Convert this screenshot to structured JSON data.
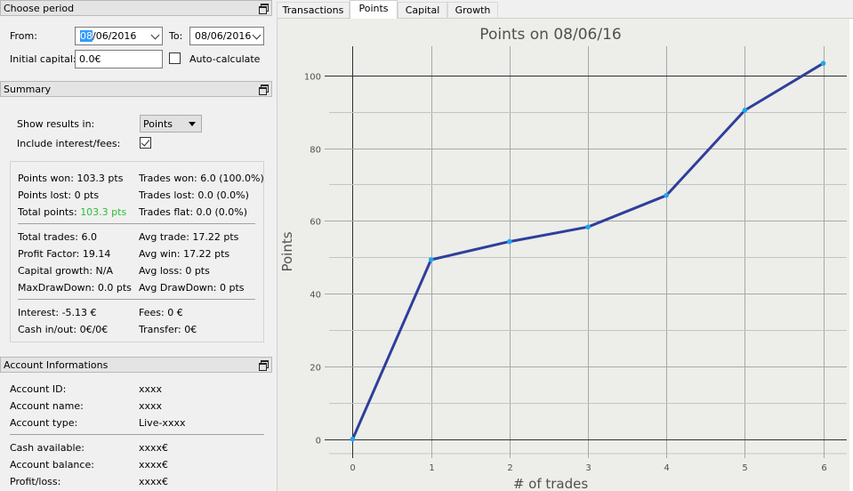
{
  "choose_period": {
    "title": "Choose period",
    "from_label": "From:",
    "from_value_hl": "08",
    "from_value_rest": "/06/2016",
    "to_label": "To:",
    "to_value": "08/06/2016",
    "initial_capital_label": "Initial capital:",
    "initial_capital_value": "0.0€",
    "auto_calculate_label": "Auto-calculate",
    "auto_calculate_checked": false
  },
  "summary": {
    "title": "Summary",
    "show_results_label": "Show results in:",
    "show_results_value": "Points",
    "include_interest_label": "Include interest/fees:",
    "include_interest_checked": true,
    "points_won": "Points won: 103.3 pts",
    "points_lost": "Points lost: 0 pts",
    "total_points_label": "Total points:",
    "total_points_value": "103.3 pts",
    "trades_won": "Trades won: 6.0 (100.0%)",
    "trades_lost": "Trades lost: 0.0 (0.0%)",
    "trades_flat": "Trades flat: 0.0 (0.0%)",
    "total_trades": "Total trades: 6.0",
    "profit_factor": "Profit Factor: 19.14",
    "capital_growth": "Capital growth: N/A",
    "max_drawdown": "MaxDrawDown: 0.0 pts",
    "avg_trade": "Avg trade: 17.22 pts",
    "avg_win": "Avg win: 17.22 pts",
    "avg_loss": "Avg loss: 0 pts",
    "avg_drawdown": "Avg DrawDown: 0 pts",
    "interest": "Interest: -5.13 €",
    "cash_in_out": "Cash in/out: 0€/0€",
    "fees": "Fees: 0 €",
    "transfer": "Transfer: 0€"
  },
  "account": {
    "title": "Account Informations",
    "rows": [
      {
        "label": "Account ID:",
        "value": "xxxx"
      },
      {
        "label": "Account name:",
        "value": "xxxx"
      },
      {
        "label": "Account type:",
        "value": "Live-xxxx"
      },
      {
        "label": "Cash available:",
        "value": "xxxx€"
      },
      {
        "label": "Account balance:",
        "value": "xxxx€"
      },
      {
        "label": "Profit/loss:",
        "value": "xxxx€"
      }
    ]
  },
  "tabs": [
    {
      "label": "Transactions",
      "active": false
    },
    {
      "label": "Points",
      "active": true
    },
    {
      "label": "Capital",
      "active": false
    },
    {
      "label": "Growth",
      "active": false
    }
  ],
  "colors": {
    "line": "#2e3f9a",
    "marker": "#1ea8f0",
    "positive": "#2dbd36"
  },
  "chart_data": {
    "type": "line",
    "title": "Points on 08/06/16",
    "xlabel": "# of trades",
    "ylabel": "Points",
    "x": [
      0,
      1,
      2,
      3,
      4,
      5,
      6
    ],
    "y": [
      0,
      49.3,
      54.3,
      58.3,
      67.0,
      90.4,
      103.3
    ],
    "xlim": [
      -0.3,
      6.3
    ],
    "ylim": [
      -4,
      108
    ],
    "xticks": [
      0,
      1,
      2,
      3,
      4,
      5,
      6
    ],
    "yticks": [
      0,
      20,
      40,
      60,
      80,
      100
    ],
    "grid": true
  }
}
